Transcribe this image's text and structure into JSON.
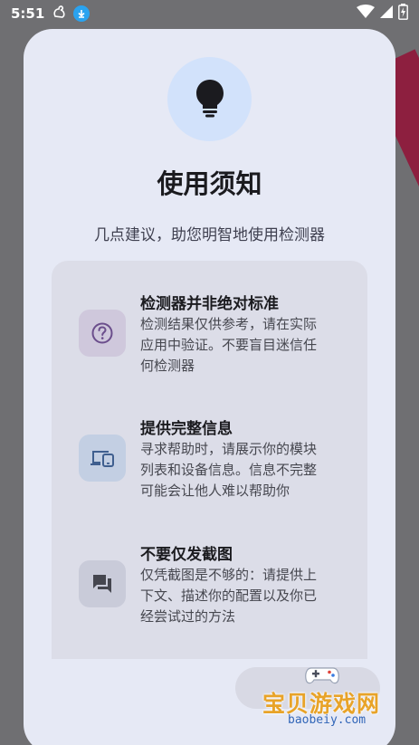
{
  "status_bar": {
    "time": "5:51",
    "left_icons": [
      "duck-icon",
      "download-icon"
    ],
    "right_icons": [
      "wifi-icon",
      "signal-icon",
      "battery-charging-icon"
    ]
  },
  "dialog": {
    "hero_icon": "lightbulb-icon",
    "title": "使用须知",
    "subtitle": "几点建议，助您明智地使用检测器",
    "items": [
      {
        "icon": "help-circle-icon",
        "title": "检测器并非绝对标准",
        "desc_lines": [
          "检测结果仅供参考，请在实际",
          "应用中验证。不要盲目迷信任",
          "何检测器"
        ]
      },
      {
        "icon": "devices-icon",
        "title": "提供完整信息",
        "desc_lines": [
          "寻求帮助时，请展示你的模块",
          "列表和设备信息。信息不完整",
          "可能会让他人难以帮助你"
        ]
      },
      {
        "icon": "chat-icon",
        "title": "不要仅发截图",
        "desc_lines": [
          "仅凭截图是不够的：请提供上",
          "下文、描述你的配置以及你已",
          "经尝试过的方法"
        ]
      }
    ]
  },
  "watermark": {
    "text": "宝贝游戏网",
    "url": "baobeiy.com"
  },
  "colors": {
    "dialog_bg": "#e6e9f5",
    "card_bg": "#dcdde8",
    "accent_purple": "#6b4e8c",
    "accent_blue": "#3f5f8f",
    "watermark_orange": "#e8a328"
  }
}
